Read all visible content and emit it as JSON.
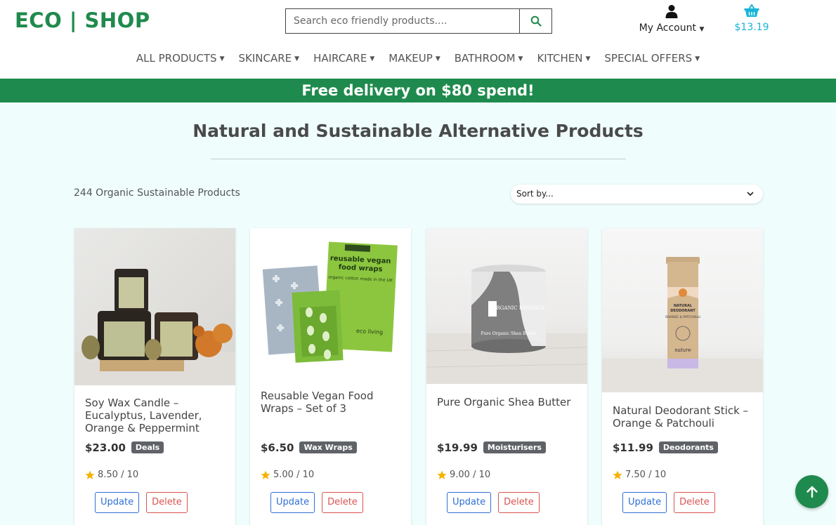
{
  "header": {
    "logo": "ECO | SHOP",
    "search": {
      "placeholder": "Search eco friendly products....",
      "icon": "search-icon"
    },
    "account": {
      "label": "My Account",
      "icon": "user-icon"
    },
    "basket": {
      "amount": "$13.19",
      "icon": "basket-icon"
    }
  },
  "nav": {
    "items": [
      {
        "label": "ALL PRODUCTS"
      },
      {
        "label": "SKINCARE"
      },
      {
        "label": "HAIRCARE"
      },
      {
        "label": "MAKEUP"
      },
      {
        "label": "BATHROOM"
      },
      {
        "label": "KITCHEN"
      },
      {
        "label": "SPECIAL OFFERS"
      }
    ]
  },
  "banner": {
    "text": "Free delivery on $80 spend!"
  },
  "main": {
    "title": "Natural and Sustainable Alternative Products",
    "count_text": "244 Organic Sustainable Products",
    "sort": {
      "selected": "Sort by..."
    }
  },
  "products": [
    {
      "name": "Soy Wax Candle – Eucalyptus, Lavender, Orange & Peppermint",
      "price": "$23.00",
      "category": "Deals",
      "rating": "8.50 / 10",
      "update_label": "Update",
      "delete_label": "Delete"
    },
    {
      "name": "Reusable Vegan Food Wraps – Set of 3",
      "price": "$6.50",
      "category": "Wax Wraps",
      "rating": "5.00 / 10",
      "update_label": "Update",
      "delete_label": "Delete"
    },
    {
      "name": "Pure Organic Shea Butter",
      "price": "$19.99",
      "category": "Moisturisers",
      "rating": "9.00 / 10",
      "update_label": "Update",
      "delete_label": "Delete"
    },
    {
      "name": "Natural Deodorant Stick – Orange & Patchouli",
      "price": "$11.99",
      "category": "Deodorants",
      "rating": "7.50 / 10",
      "update_label": "Update",
      "delete_label": "Delete"
    }
  ],
  "image_text": {
    "wraps_title": "reusable vegan food wraps",
    "wraps_sub": "organic cotton made in the UK",
    "wraps_brand": "eco living",
    "shea_brand": "ORGANIC ESSENCE",
    "shea_label": "Pure Organic Shea Butter",
    "deo_title": "NATURAL DEODORANT",
    "deo_sub": "ORANGE & PATCHOULI",
    "deo_brand": "nature"
  },
  "colors": {
    "brand_green": "#1f8a4d",
    "basket_blue": "#1ab5d8",
    "update_blue": "#2e6fd6",
    "delete_red": "#d9534f",
    "page_bg": "#effdfd"
  },
  "back_to_top": {
    "icon": "arrow-up-icon"
  }
}
